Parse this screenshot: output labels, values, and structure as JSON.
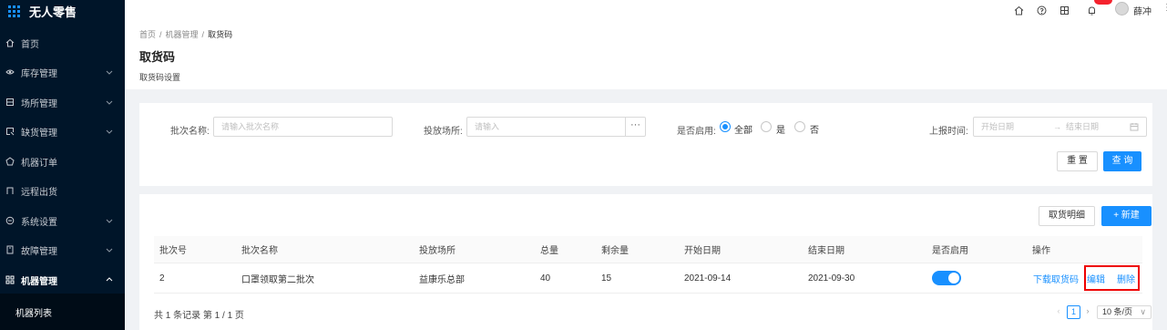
{
  "app": {
    "title": "无人零售"
  },
  "sidebar": {
    "items": [
      {
        "label": "首页",
        "icon": "home-icon"
      },
      {
        "label": "库存管理",
        "icon": "stock-icon"
      },
      {
        "label": "场所管理",
        "icon": "venue-icon"
      },
      {
        "label": "缺货管理",
        "icon": "shortage-icon"
      },
      {
        "label": "机器订单",
        "icon": "order-icon"
      },
      {
        "label": "远程出货",
        "icon": "remote-icon"
      },
      {
        "label": "系统设置",
        "icon": "settings-icon"
      },
      {
        "label": "故障管理",
        "icon": "fault-icon"
      },
      {
        "label": "机器管理",
        "icon": "machine-icon"
      }
    ],
    "sub_item": "机器列表"
  },
  "topbar": {
    "user": "薛冲",
    "more": "⋮"
  },
  "breadcrumb": {
    "items": [
      "首页",
      "机器管理",
      "取货码"
    ],
    "sep": "/"
  },
  "page": {
    "title": "取货码",
    "subtitle": "取货码设置"
  },
  "filter": {
    "batch_name_label": "批次名称:",
    "batch_name_placeholder": "请输入批次名称",
    "venue_label": "投放场所:",
    "venue_placeholder": "请输入",
    "venue_more": "···",
    "enabled_label": "是否启用:",
    "enabled_options": [
      "全部",
      "是",
      "否"
    ],
    "enabled_selected": "全部",
    "report_time_label": "上报时间:",
    "start_placeholder": "开始日期",
    "range_arrow": "→",
    "end_placeholder": "结束日期",
    "reset_label": "重 置",
    "query_label": "查 询"
  },
  "table": {
    "detail_button": "取货明细",
    "new_button": "+ 新建",
    "headers": [
      "批次号",
      "批次名称",
      "投放场所",
      "总量",
      "剩余量",
      "开始日期",
      "结束日期",
      "是否启用",
      "操作"
    ],
    "rows": [
      {
        "batch_no": "2",
        "name": "口罩领取第二批次",
        "venue": "益康乐总部",
        "total": "40",
        "remaining": "15",
        "start": "2021-09-14",
        "end": "2021-09-30",
        "enabled": true,
        "actions": [
          "下载取货码",
          "编辑",
          "删除"
        ]
      }
    ],
    "summary": "共 1 条记录 第 1 / 1 页",
    "current_page": "1",
    "page_size": "10 条/页",
    "prev": "‹",
    "next": "›",
    "dropdown": "∨"
  },
  "colors": {
    "sidebar_bg": "#001529",
    "accent": "#1890ff",
    "highlight": "#e00000"
  }
}
